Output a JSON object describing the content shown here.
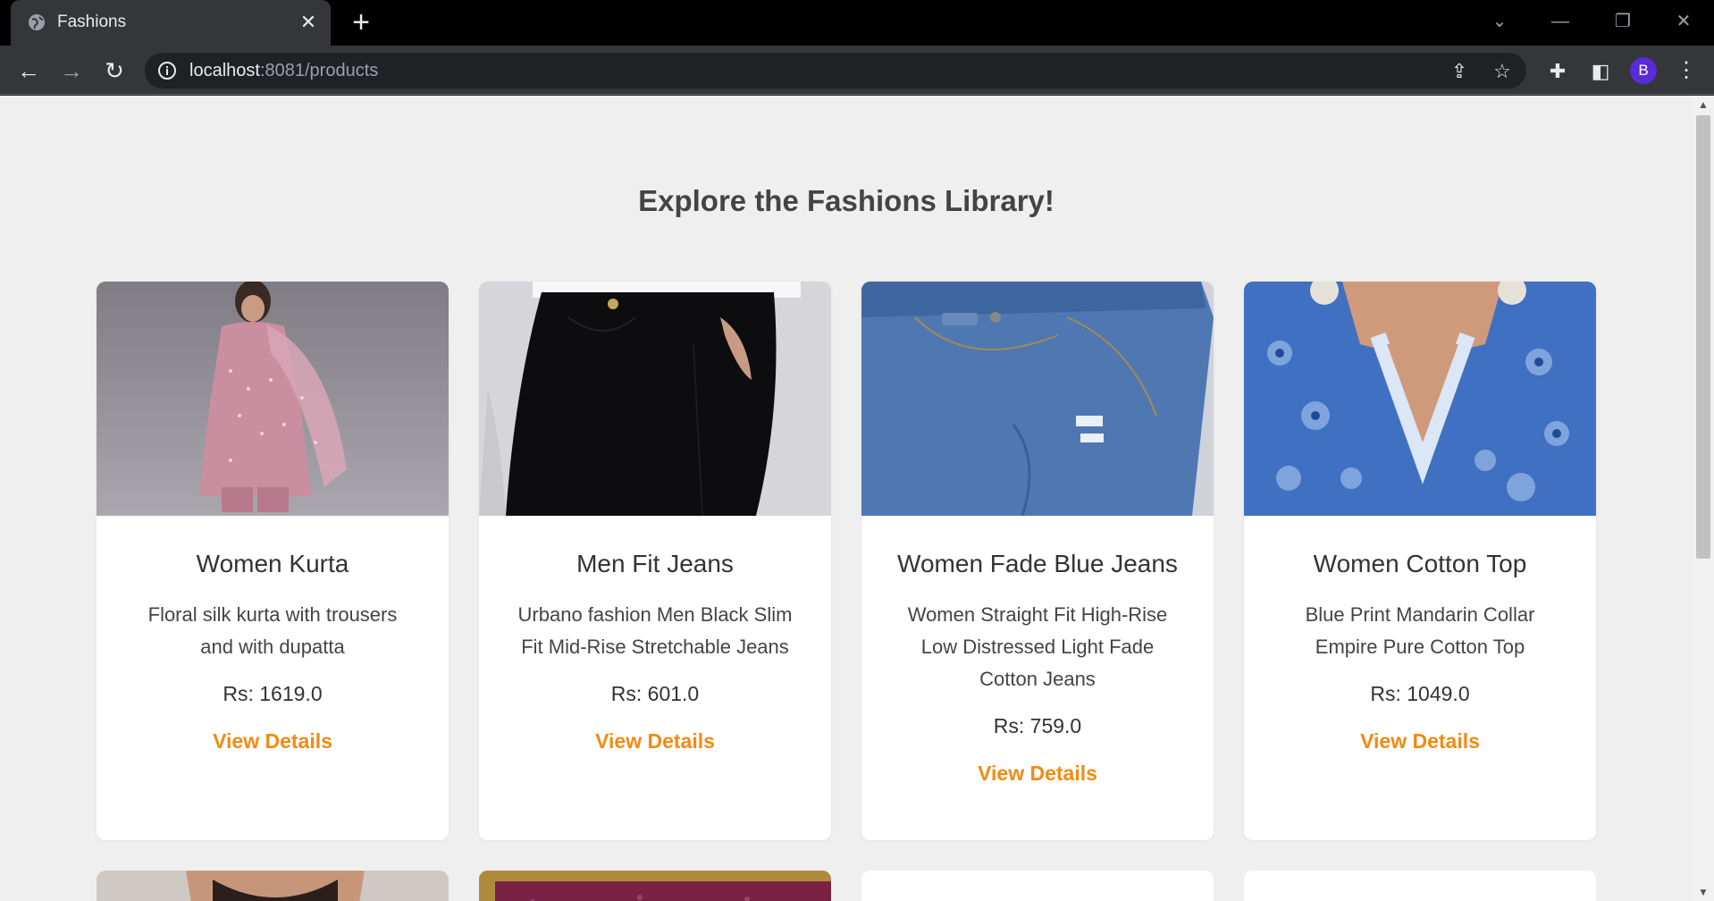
{
  "browser": {
    "tab_title": "Fashions",
    "url_host": "localhost",
    "url_rest": ":8081/products",
    "profile_initial": "B"
  },
  "page": {
    "heading": "Explore the Fashions Library!"
  },
  "products": [
    {
      "name": "Women Kurta",
      "description": "Floral silk kurta with trousers and with dupatta",
      "price": "Rs: 1619.0",
      "link": "View Details"
    },
    {
      "name": "Men Fit Jeans",
      "description": "Urbano fashion Men Black Slim Fit Mid-Rise Stretchable Jeans",
      "price": "Rs: 601.0",
      "link": "View Details"
    },
    {
      "name": "Women Fade Blue Jeans",
      "description": "Women Straight Fit High-Rise Low Distressed Light Fade Cotton Jeans",
      "price": "Rs: 759.0",
      "link": "View Details"
    },
    {
      "name": "Women Cotton Top",
      "description": "Blue Print Mandarin Collar Empire Pure Cotton Top",
      "price": "Rs: 1049.0",
      "link": "View Details"
    }
  ],
  "colors": {
    "accent": "#f28a13",
    "page_bg": "#efefef"
  }
}
